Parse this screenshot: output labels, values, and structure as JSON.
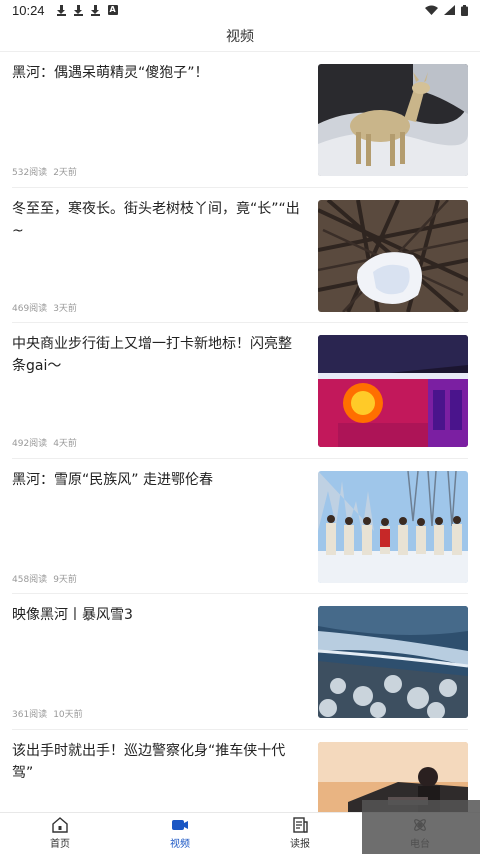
{
  "status_bar": {
    "time": "10:24"
  },
  "header": {
    "title": "视频"
  },
  "articles": [
    {
      "title": "黑河：偶遇呆萌精灵“傻狍子”！",
      "reads": "532阅读",
      "time": "2天前"
    },
    {
      "title": "冬至至，寒夜长。街头老树枝丫间，竟“长”“出~",
      "reads": "469阅读",
      "time": "3天前"
    },
    {
      "title": "中央商业步行街上又增一打卡新地标！闪亮整条gai～",
      "reads": "492阅读",
      "time": "4天前"
    },
    {
      "title": "黑河：雪原“民族风” 走进鄂伦春",
      "reads": "458阅读",
      "time": "9天前"
    },
    {
      "title": "映像黑河丨暴风雪3",
      "reads": "361阅读",
      "time": "10天前"
    },
    {
      "title": "该出手时就出手！巡边警察化身“推车侠十代驾”",
      "reads": "",
      "time": ""
    }
  ],
  "tabs": [
    {
      "label": "首页",
      "icon": "home-icon"
    },
    {
      "label": "视频",
      "icon": "video-icon"
    },
    {
      "label": "读报",
      "icon": "newspaper-icon"
    },
    {
      "label": "电台",
      "icon": "radio-icon"
    }
  ],
  "colors": {
    "accent": "#1a56c4",
    "meta": "#999999",
    "divider": "#eeeeee"
  }
}
